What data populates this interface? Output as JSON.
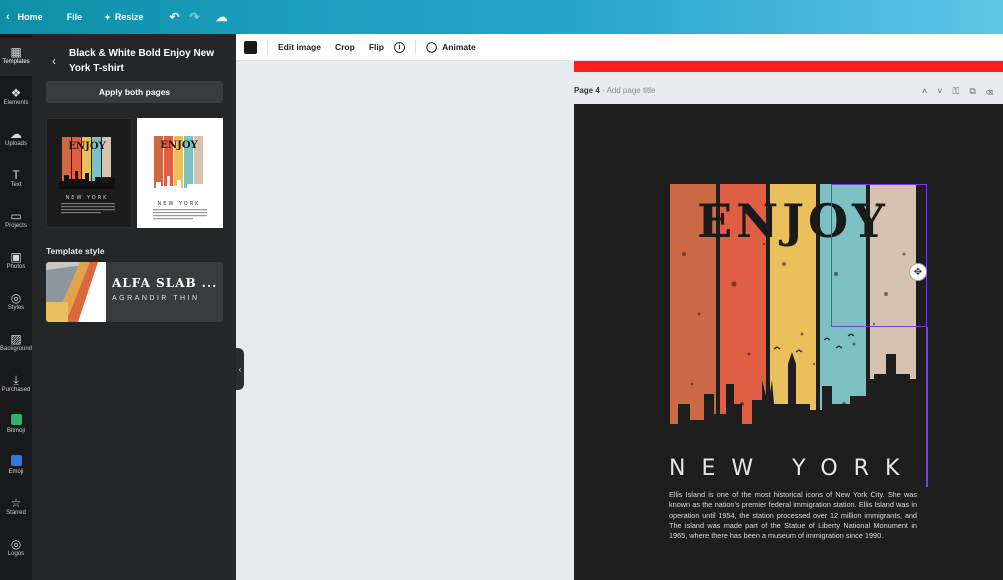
{
  "topbar": {
    "home_label": "Home",
    "file_label": "File",
    "resize_label": "Resize"
  },
  "rail": {
    "items": [
      {
        "label": "Templates",
        "icon": "templates-icon"
      },
      {
        "label": "Elements",
        "icon": "elements-icon"
      },
      {
        "label": "Uploads",
        "icon": "uploads-icon"
      },
      {
        "label": "Text",
        "icon": "text-icon"
      },
      {
        "label": "Projects",
        "icon": "folder-icon"
      },
      {
        "label": "Photos",
        "icon": "photos-icon"
      },
      {
        "label": "Styles",
        "icon": "palette-icon"
      },
      {
        "label": "Background",
        "icon": "background-icon"
      },
      {
        "label": "Purchased",
        "icon": "download-icon"
      },
      {
        "label": "Bitmoji",
        "icon": "bitmoji-icon"
      },
      {
        "label": "Emoji",
        "icon": "emoji-icon"
      },
      {
        "label": "Starred",
        "icon": "star-icon"
      },
      {
        "label": "Logos",
        "icon": "logos-icon"
      }
    ]
  },
  "panel": {
    "title": "Black & White Bold Enjoy New York T-shirt",
    "apply_label": "Apply both pages",
    "template_style_label": "Template style",
    "style_font_primary": "ALFA SLAB ...",
    "style_font_secondary": "AGRANDIR THIN",
    "style_colors": [
      "#c9c8c0",
      "#e2a34a",
      "#d9683e",
      "#8d97a0",
      "#ffffff"
    ]
  },
  "toolbar": {
    "color_swatch": "#1a1a1a",
    "edit_image_label": "Edit image",
    "crop_label": "Crop",
    "flip_label": "Flip",
    "info_symbol": "i",
    "animate_label": "Animate"
  },
  "page": {
    "label": "Page 4",
    "title_placeholder": " - Add page title",
    "background": "#1e1e1e",
    "enjoy_text": "ENJOY",
    "city_text": "NEW YORK",
    "description": "Ellis Island is one of the most historical icons of New York City. She was known as the nation's premier federal immigration station. Ellis Island was in operation until 1954, the station processed over 12 million immigrants, and The island was made part of the Statue of Liberty National Monument in 1965, where there has been a museum of immigration since 1990.",
    "stripe_colors": [
      "#cc6a46",
      "#e05e44",
      "#e9c05b",
      "#7cc0c4",
      "#d7c2b0"
    ],
    "selection_color": "#7a3fe0",
    "accent_strip_color": "#ff1d1d"
  },
  "thumbnails": {
    "dark_enjoy": "ENJOY",
    "dark_city": "NEW YORK",
    "light_enjoy": "ENJOY",
    "light_city": "NEW YORK"
  }
}
